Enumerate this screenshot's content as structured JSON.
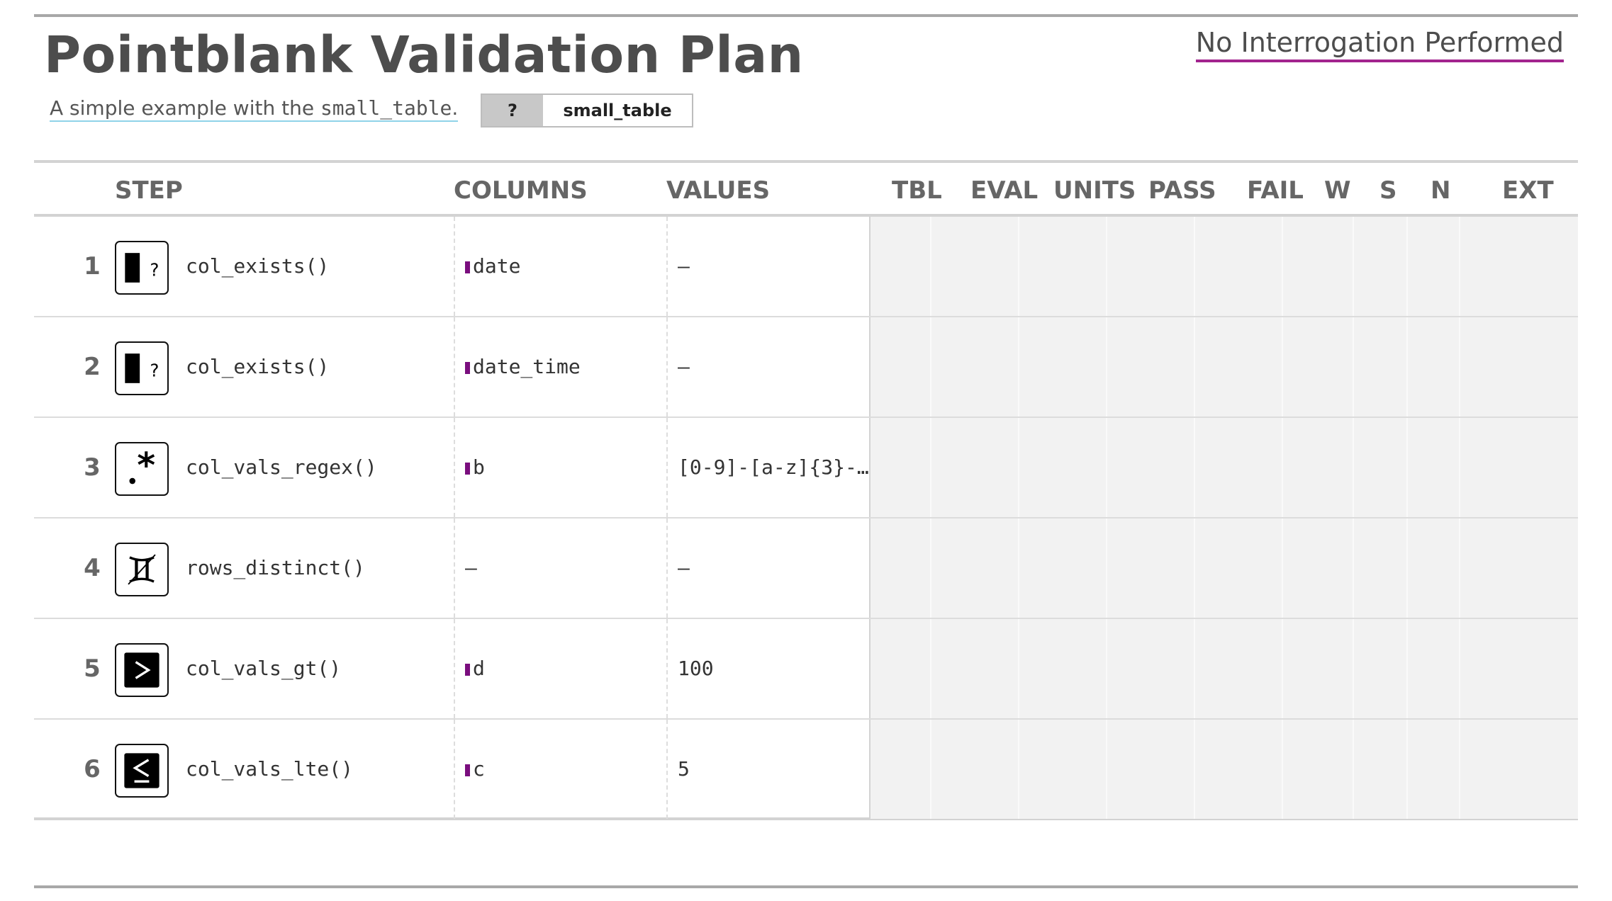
{
  "header": {
    "title": "Pointblank Validation Plan",
    "status": "No Interrogation Performed",
    "subtitle_prefix": "A simple example with the ",
    "subtitle_code": "small_table",
    "subtitle_suffix": ".",
    "badge_symbol": "?",
    "badge_table_name": "small_table"
  },
  "columns": {
    "step": "STEP",
    "columns": "COLUMNS",
    "values": "VALUES",
    "tbl": "TBL",
    "eval": "EVAL",
    "units": "UNITS",
    "pass": "PASS",
    "fail": "FAIL",
    "w": "W",
    "s": "S",
    "n": "N",
    "ext": "EXT"
  },
  "accent_colors": {
    "status_underline": "#a2238e",
    "column_marker": "#7a0e7e",
    "subtitle_underline": "#8fd3e8"
  },
  "steps": [
    {
      "num": "1",
      "icon": "col-exists-icon",
      "fn": "col_exists()",
      "column": "date",
      "value": "—",
      "has_marker": true
    },
    {
      "num": "2",
      "icon": "col-exists-icon",
      "fn": "col_exists()",
      "column": "date_time",
      "value": "—",
      "has_marker": true
    },
    {
      "num": "3",
      "icon": "regex-icon",
      "fn": "col_vals_regex()",
      "column": "b",
      "value": "[0-9]-[a-z]{3}-…",
      "has_marker": true
    },
    {
      "num": "4",
      "icon": "gemini-icon",
      "fn": "rows_distinct()",
      "column": "—",
      "value": "—",
      "has_marker": false
    },
    {
      "num": "5",
      "icon": "greater-than-icon",
      "fn": "col_vals_gt()",
      "column": "d",
      "value": "100",
      "has_marker": true
    },
    {
      "num": "6",
      "icon": "less-equal-icon",
      "fn": "col_vals_lte()",
      "column": "c",
      "value": "5",
      "has_marker": true
    }
  ]
}
